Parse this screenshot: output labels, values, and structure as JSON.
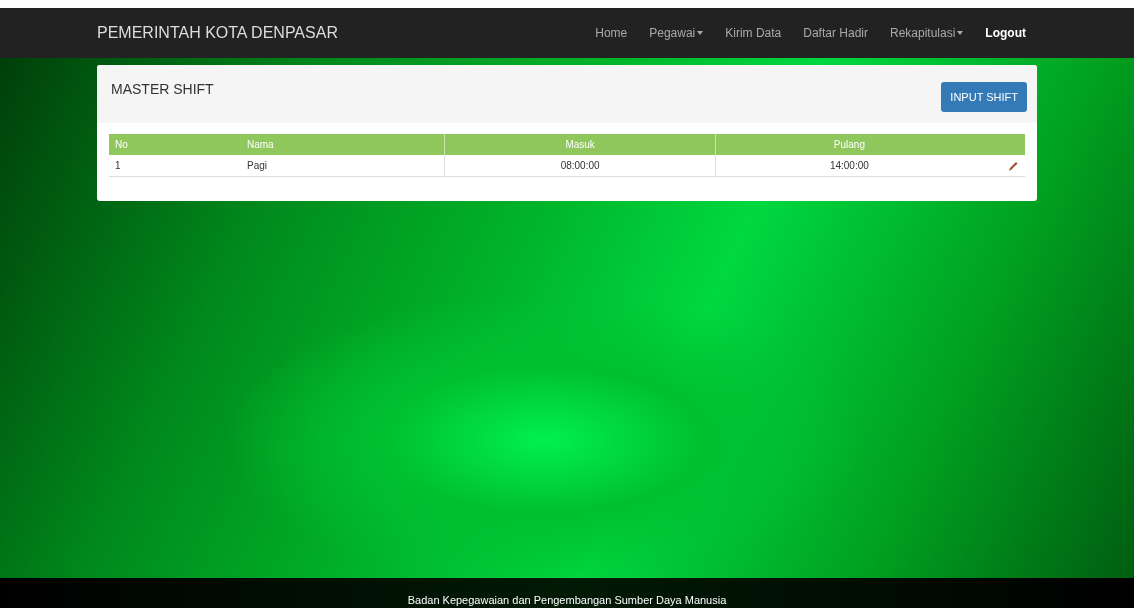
{
  "navbar": {
    "brand": "PEMERINTAH KOTA DENPASAR",
    "items": [
      {
        "label": "Home",
        "dropdown": false,
        "bold": false
      },
      {
        "label": "Pegawai",
        "dropdown": true,
        "bold": false
      },
      {
        "label": "Kirim Data",
        "dropdown": false,
        "bold": false
      },
      {
        "label": "Daftar Hadir",
        "dropdown": false,
        "bold": false
      },
      {
        "label": "Rekapitulasi",
        "dropdown": true,
        "bold": false
      },
      {
        "label": "Logout",
        "dropdown": false,
        "bold": true
      }
    ]
  },
  "panel": {
    "title": "MASTER SHIFT",
    "button": "INPUT SHIFT",
    "table": {
      "columns": [
        "No",
        "Nama",
        "Masuk",
        "Pulang"
      ],
      "rows": [
        {
          "cells": [
            "1",
            "Pagi",
            "08:00:00",
            "14:00:00"
          ]
        }
      ]
    }
  },
  "footer": {
    "text": "Badan Kepegawaian dan Pengembangan Sumber Daya Manusia"
  }
}
